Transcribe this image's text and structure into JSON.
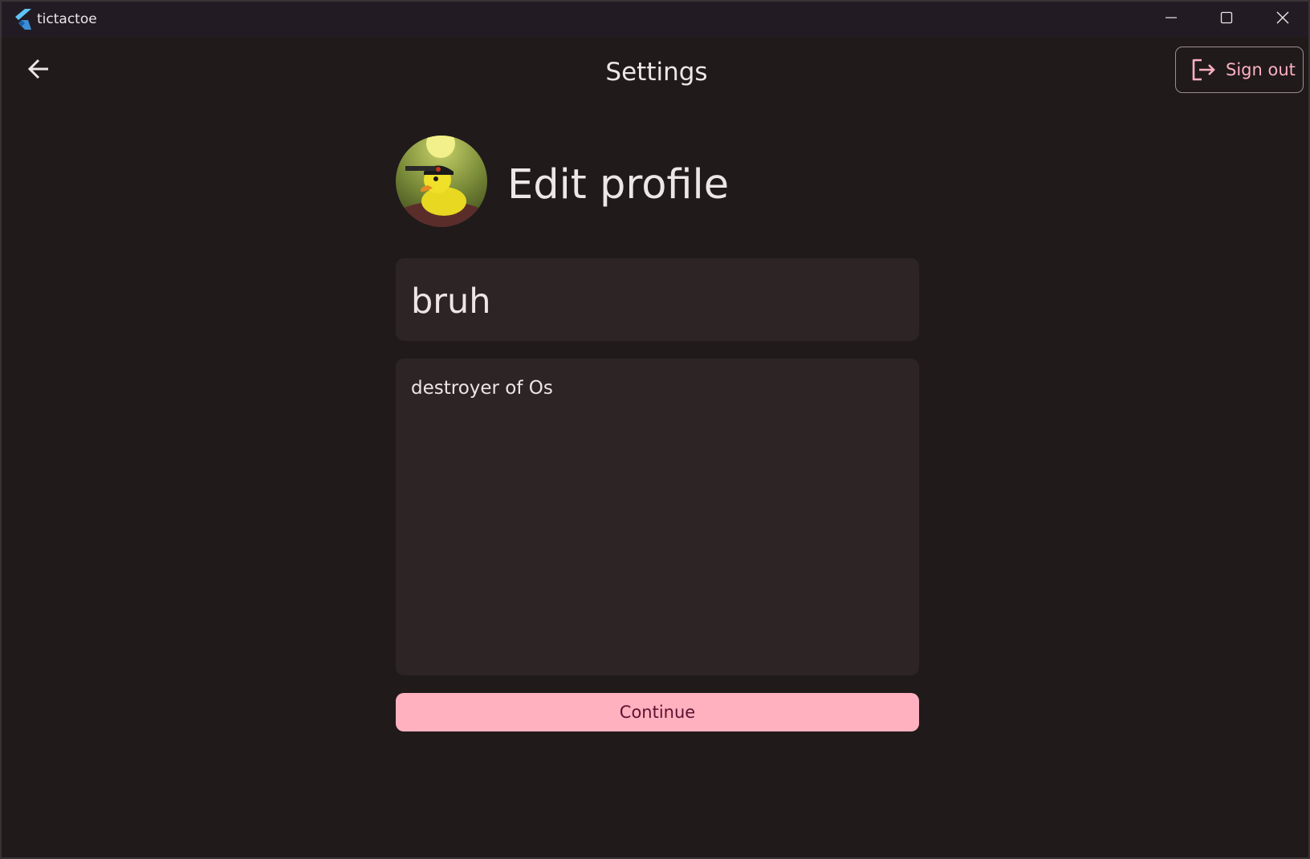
{
  "window": {
    "title": "tictactoe",
    "logo_icon": "flutter-logo-icon",
    "controls": [
      "minimize-icon",
      "maximize-icon",
      "close-icon"
    ]
  },
  "header": {
    "back_icon": "arrow-left-icon",
    "title": "Settings",
    "sign_out_label": "Sign out",
    "sign_out_icon": "logout-icon"
  },
  "profile": {
    "heading": "Edit profile",
    "avatar_desc": "rubber-duck-avatar",
    "name_value": "bruh",
    "bio_value": "destroyer of Os",
    "continue_label": "Continue"
  },
  "colors": {
    "background": "#201a1b",
    "surface": "#2d2426",
    "accent": "#ffb1c0",
    "on_accent": "#5e1130",
    "text": "#ece6e7"
  }
}
